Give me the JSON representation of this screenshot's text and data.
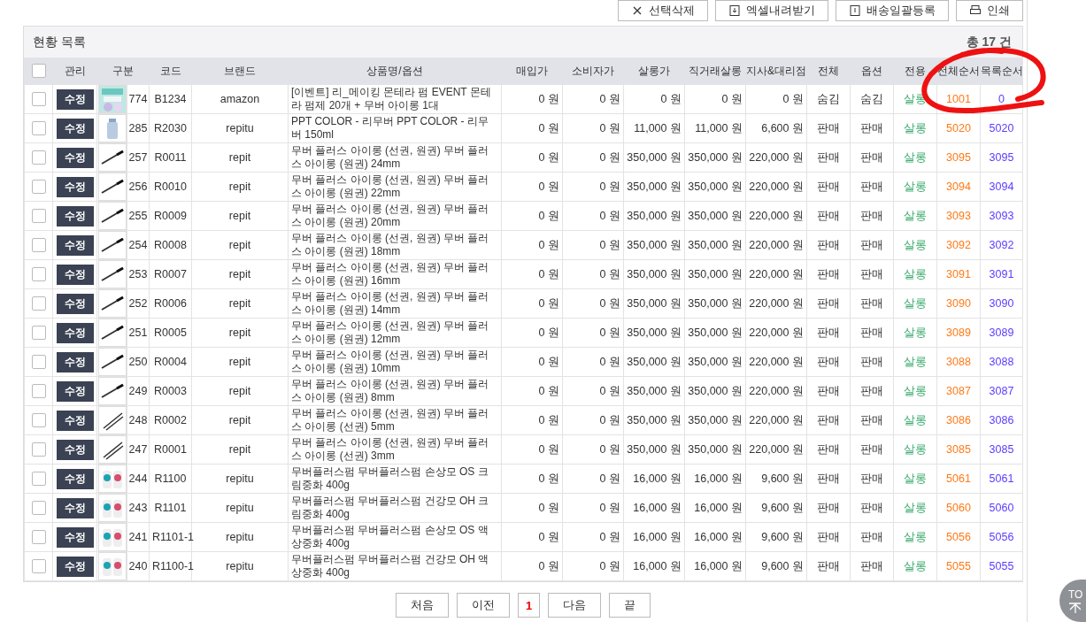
{
  "toolbar": [
    "선택삭제",
    "엑셀내려받기",
    "배송일괄등록",
    "인쇄"
  ],
  "panel": {
    "title": "현황 목록",
    "total": "총 17 건"
  },
  "table": {
    "header_checkbox": {
      "checked": false
    },
    "columns": [
      "관리",
      "구분",
      "코드",
      "브랜드",
      "상품명/옵션",
      "매입가",
      "소비자가",
      "살롱가",
      "직거래살롱",
      "지사&대리점",
      "전체",
      "옵션",
      "전용",
      "전체순서",
      "목록순서"
    ],
    "rows": [
      {
        "checked": false,
        "edit": "수정",
        "no": "774",
        "code": "B1234",
        "brand": "amazon",
        "name": "[이벤트] 리_메이킹 몬테라 펌 EVENT 몬테라 펌제 20개 + 무버 아이롱 1대",
        "prices": [
          "0 원",
          "0 원",
          "0 원",
          "0 원",
          "0 원"
        ],
        "all": "숨김",
        "option": "숨김",
        "exclusive": "살롱",
        "total_order": "1001",
        "list_order": "0"
      },
      {
        "checked": false,
        "edit": "수정",
        "no": "285",
        "code": "R2030",
        "brand": "repitu",
        "name": "PPT COLOR - 리무버 PPT COLOR - 리무버 150ml",
        "prices": [
          "0 원",
          "0 원",
          "11,000 원",
          "11,000 원",
          "6,600 원"
        ],
        "all": "판매",
        "option": "판매",
        "exclusive": "살롱",
        "total_order": "5020",
        "list_order": "5020"
      },
      {
        "checked": false,
        "edit": "수정",
        "no": "257",
        "code": "R0011",
        "brand": "repit",
        "name": "무버 플러스 아이롱 (선권, 원권) 무버 플러스 아이롱 (원권) 24mm",
        "prices": [
          "0 원",
          "0 원",
          "350,000 원",
          "350,000 원",
          "220,000 원"
        ],
        "all": "판매",
        "option": "판매",
        "exclusive": "살롱",
        "total_order": "3095",
        "list_order": "3095"
      },
      {
        "checked": false,
        "edit": "수정",
        "no": "256",
        "code": "R0010",
        "brand": "repit",
        "name": "무버 플러스 아이롱 (선권, 원권) 무버 플러스 아이롱 (원권) 22mm",
        "prices": [
          "0 원",
          "0 원",
          "350,000 원",
          "350,000 원",
          "220,000 원"
        ],
        "all": "판매",
        "option": "판매",
        "exclusive": "살롱",
        "total_order": "3094",
        "list_order": "3094"
      },
      {
        "checked": false,
        "edit": "수정",
        "no": "255",
        "code": "R0009",
        "brand": "repit",
        "name": "무버 플러스 아이롱 (선권, 원권) 무버 플러스 아이롱 (원권) 20mm",
        "prices": [
          "0 원",
          "0 원",
          "350,000 원",
          "350,000 원",
          "220,000 원"
        ],
        "all": "판매",
        "option": "판매",
        "exclusive": "살롱",
        "total_order": "3093",
        "list_order": "3093"
      },
      {
        "checked": false,
        "edit": "수정",
        "no": "254",
        "code": "R0008",
        "brand": "repit",
        "name": "무버 플러스 아이롱 (선권, 원권) 무버 플러스 아이롱 (원권) 18mm",
        "prices": [
          "0 원",
          "0 원",
          "350,000 원",
          "350,000 원",
          "220,000 원"
        ],
        "all": "판매",
        "option": "판매",
        "exclusive": "살롱",
        "total_order": "3092",
        "list_order": "3092"
      },
      {
        "checked": false,
        "edit": "수정",
        "no": "253",
        "code": "R0007",
        "brand": "repit",
        "name": "무버 플러스 아이롱 (선권, 원권) 무버 플러스 아이롱 (원권) 16mm",
        "prices": [
          "0 원",
          "0 원",
          "350,000 원",
          "350,000 원",
          "220,000 원"
        ],
        "all": "판매",
        "option": "판매",
        "exclusive": "살롱",
        "total_order": "3091",
        "list_order": "3091"
      },
      {
        "checked": false,
        "edit": "수정",
        "no": "252",
        "code": "R0006",
        "brand": "repit",
        "name": "무버 플러스 아이롱 (선권, 원권) 무버 플러스 아이롱 (원권) 14mm",
        "prices": [
          "0 원",
          "0 원",
          "350,000 원",
          "350,000 원",
          "220,000 원"
        ],
        "all": "판매",
        "option": "판매",
        "exclusive": "살롱",
        "total_order": "3090",
        "list_order": "3090"
      },
      {
        "checked": false,
        "edit": "수정",
        "no": "251",
        "code": "R0005",
        "brand": "repit",
        "name": "무버 플러스 아이롱 (선권, 원권) 무버 플러스 아이롱 (원권) 12mm",
        "prices": [
          "0 원",
          "0 원",
          "350,000 원",
          "350,000 원",
          "220,000 원"
        ],
        "all": "판매",
        "option": "판매",
        "exclusive": "살롱",
        "total_order": "3089",
        "list_order": "3089"
      },
      {
        "checked": false,
        "edit": "수정",
        "no": "250",
        "code": "R0004",
        "brand": "repit",
        "name": "무버 플러스 아이롱 (선권, 원권) 무버 플러스 아이롱 (원권) 10mm",
        "prices": [
          "0 원",
          "0 원",
          "350,000 원",
          "350,000 원",
          "220,000 원"
        ],
        "all": "판매",
        "option": "판매",
        "exclusive": "살롱",
        "total_order": "3088",
        "list_order": "3088"
      },
      {
        "checked": false,
        "edit": "수정",
        "no": "249",
        "code": "R0003",
        "brand": "repit",
        "name": "무버 플러스 아이롱 (선권, 원권) 무버 플러스 아이롱 (원권) 8mm",
        "prices": [
          "0 원",
          "0 원",
          "350,000 원",
          "350,000 원",
          "220,000 원"
        ],
        "all": "판매",
        "option": "판매",
        "exclusive": "살롱",
        "total_order": "3087",
        "list_order": "3087"
      },
      {
        "checked": false,
        "edit": "수정",
        "no": "248",
        "code": "R0002",
        "brand": "repit",
        "name": "무버 플러스 아이롱 (선권, 원권) 무버 플러스 아이롱 (선권) 5mm",
        "prices": [
          "0 원",
          "0 원",
          "350,000 원",
          "350,000 원",
          "220,000 원"
        ],
        "all": "판매",
        "option": "판매",
        "exclusive": "살롱",
        "total_order": "3086",
        "list_order": "3086"
      },
      {
        "checked": false,
        "edit": "수정",
        "no": "247",
        "code": "R0001",
        "brand": "repit",
        "name": "무버 플러스 아이롱 (선권, 원권) 무버 플러스 아이롱 (선권) 3mm",
        "prices": [
          "0 원",
          "0 원",
          "350,000 원",
          "350,000 원",
          "220,000 원"
        ],
        "all": "판매",
        "option": "판매",
        "exclusive": "살롱",
        "total_order": "3085",
        "list_order": "3085"
      },
      {
        "checked": false,
        "edit": "수정",
        "no": "244",
        "code": "R1100",
        "brand": "repitu",
        "name": "무버플러스펌  무버플러스펌 손상모 OS 크림중화 400g",
        "prices": [
          "0 원",
          "0 원",
          "16,000 원",
          "16,000 원",
          "9,600 원"
        ],
        "all": "판매",
        "option": "판매",
        "exclusive": "살롱",
        "total_order": "5061",
        "list_order": "5061"
      },
      {
        "checked": false,
        "edit": "수정",
        "no": "243",
        "code": "R1101",
        "brand": "repitu",
        "name": "무버플러스펌  무버플러스펌 건강모 OH 크림중화 400g",
        "prices": [
          "0 원",
          "0 원",
          "16,000 원",
          "16,000 원",
          "9,600 원"
        ],
        "all": "판매",
        "option": "판매",
        "exclusive": "살롱",
        "total_order": "5060",
        "list_order": "5060"
      },
      {
        "checked": false,
        "edit": "수정",
        "no": "241",
        "code": "R1101-1",
        "brand": "repitu",
        "name": "무버플러스펌  무버플러스펌 손상모 OS 액상중화 400g",
        "prices": [
          "0 원",
          "0 원",
          "16,000 원",
          "16,000 원",
          "9,600 원"
        ],
        "all": "판매",
        "option": "판매",
        "exclusive": "살롱",
        "total_order": "5056",
        "list_order": "5056"
      },
      {
        "checked": false,
        "edit": "수정",
        "no": "240",
        "code": "R1100-1",
        "brand": "repitu",
        "name": "무버플러스펌  무버플러스펌 건강모 OH 액상중화 400g",
        "prices": [
          "0 원",
          "0 원",
          "16,000 원",
          "16,000 원",
          "9,600 원"
        ],
        "all": "판매",
        "option": "판매",
        "exclusive": "살롱",
        "total_order": "5055",
        "list_order": "5055"
      }
    ]
  },
  "pagination": [
    {
      "label": "처음",
      "selected": false
    },
    {
      "label": "이전",
      "selected": false
    },
    {
      "label": "1",
      "selected": true
    },
    {
      "label": "다음",
      "selected": false
    },
    {
      "label": "끝",
      "selected": false
    }
  ],
  "top_button": "TO",
  "annotation": {
    "kind": "circle"
  }
}
